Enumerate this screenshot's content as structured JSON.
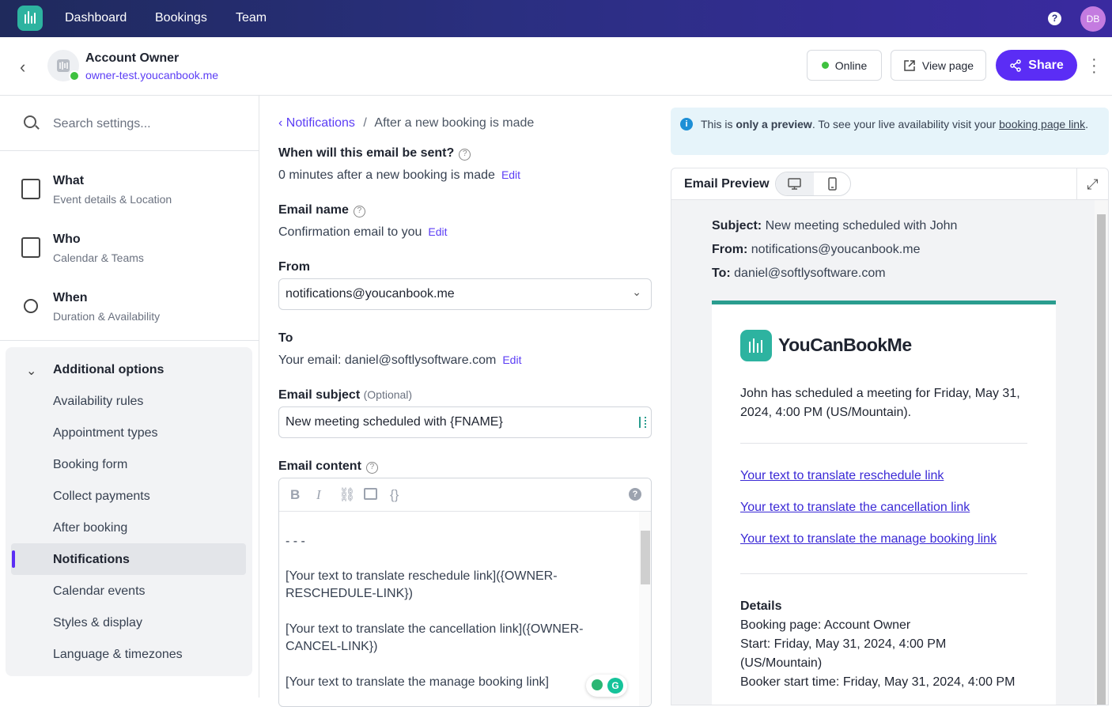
{
  "topnav": {
    "links": [
      "Dashboard",
      "Bookings",
      "Team"
    ],
    "help": "?",
    "avatar": "DB"
  },
  "header": {
    "title": "Account Owner",
    "url": "owner-test.youcanbook.me",
    "status": "Online",
    "view_page": "View page",
    "share": "Share"
  },
  "sidebar": {
    "search_placeholder": "Search settings...",
    "items": [
      {
        "title": "What",
        "sub": "Event details & Location",
        "icon": "details-icon"
      },
      {
        "title": "Who",
        "sub": "Calendar & Teams",
        "icon": "calendar-person-icon"
      },
      {
        "title": "When",
        "sub": "Duration & Availability",
        "icon": "watch-icon"
      }
    ],
    "additional": {
      "title": "Additional options",
      "options": [
        "Availability rules",
        "Appointment types",
        "Booking form",
        "Collect payments",
        "After booking",
        "Notifications",
        "Calendar events",
        "Styles & display",
        "Language & timezones"
      ],
      "active": "Notifications"
    }
  },
  "main": {
    "breadcrumb_link": "Notifications",
    "breadcrumb_current": "After a new booking is made",
    "when_label": "When will this email be sent?",
    "when_value": "0 minutes after a new booking is made",
    "edit": "Edit",
    "name_label": "Email name",
    "name_value": "Confirmation email to you",
    "from_label": "From",
    "from_value": "notifications@youcanbook.me",
    "to_label": "To",
    "to_value": "Your email: daniel@softlysoftware.com",
    "subject_label": "Email subject",
    "subject_optional": "(Optional)",
    "subject_value": "New meeting scheduled with {FNAME}",
    "content_label": "Email content",
    "content_lines": [
      "- - -",
      "[Your text to translate reschedule link]({OWNER-",
      "RESCHEDULE-LINK})",
      "[Your text to translate the cancellation link]({OWNER-",
      "CANCEL-LINK})",
      "[Your text to translate the manage booking link]"
    ]
  },
  "preview": {
    "info_pre": "This is ",
    "info_bold": "only a preview",
    "info_mid": ". To see your live availability visit your ",
    "info_link": "booking page link",
    "info_end": ".",
    "title": "Email Preview",
    "subject_label": "Subject:",
    "subject": "New meeting scheduled with John",
    "from_label": "From:",
    "from": "notifications@youcanbook.me",
    "to_label": "To:",
    "to": "daniel@softlysoftware.com",
    "brand": "YouCanBookMe",
    "body": "John has scheduled a meeting for Friday, May 31, 2024, 4:00 PM (US/Mountain).",
    "links": [
      "Your text to translate reschedule link",
      "Your text to translate the cancellation link",
      "Your text to translate the manage booking link"
    ],
    "details_title": "Details",
    "details": [
      "Booking page: Account Owner",
      "Start: Friday, May 31, 2024, 4:00 PM",
      "(US/Mountain)",
      "Booker start time: Friday, May 31, 2024, 4:00 PM"
    ]
  },
  "colors": {
    "accent": "#5b2df5",
    "brand": "#2db3a0",
    "online": "#3fc13f"
  }
}
